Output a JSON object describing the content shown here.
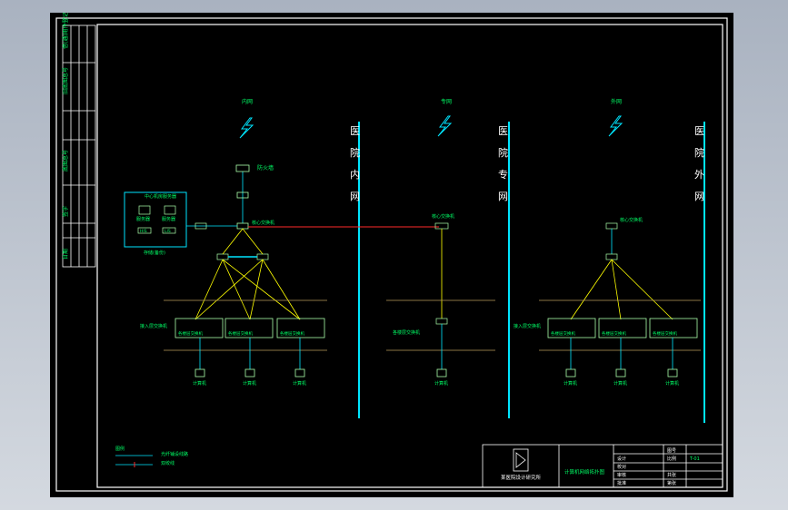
{
  "colors": {
    "background": "#000000",
    "border": "#ffffff",
    "text": "#00ff66",
    "cyan": "#00e5ff",
    "trunk": "#ff2a2a",
    "link": "#ffff00",
    "segment": "#b89a5a",
    "node": "#aaffaa"
  },
  "networks": {
    "inner": {
      "cloud_label": "内网",
      "name_chars": [
        "医",
        "院",
        "内",
        "网"
      ]
    },
    "special": {
      "cloud_label": "专网",
      "name_chars": [
        "医",
        "院",
        "专",
        "网"
      ]
    },
    "outer": {
      "cloud_label": "外网",
      "name_chars": [
        "医",
        "院",
        "外",
        "网"
      ]
    }
  },
  "left_side": {
    "top_label": "防火墙",
    "server_box_title": "中心机房服务器",
    "server_labels": [
      "服务器",
      "服务器"
    ],
    "server_sub_labels": [
      "HIS",
      "LIS"
    ],
    "storage_label": "存储(备份)",
    "core_link_label": "核心交换机",
    "access_label": "接入层交换机",
    "switch_group_label": "各楼层交换机",
    "terminal_label": "计算机"
  },
  "title_block": {
    "company": "某医院设计研究所",
    "drawing_name": "计算机网络拓扑图",
    "rows": [
      "设计",
      "校对",
      "审核",
      "批准"
    ],
    "right_cells": [
      "图号",
      "比例",
      "共张",
      "第张"
    ],
    "drawing_no": "T-01"
  },
  "legend": {
    "title": "图例",
    "items": [
      "光纤铺设线路",
      "双绞线"
    ]
  },
  "side_strip": {
    "labels": [
      "借(通)用件登记",
      "旧底图总号",
      "底图总号",
      "签字",
      "日期"
    ]
  }
}
